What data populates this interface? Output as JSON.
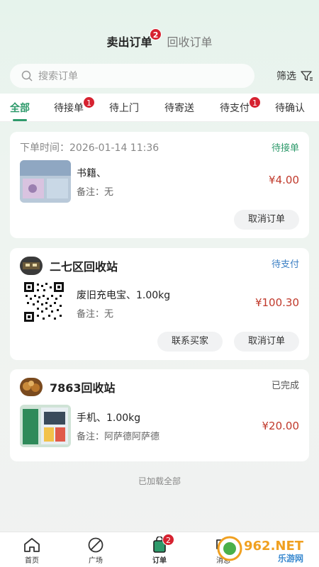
{
  "top_tabs": {
    "sell_label": "卖出订单",
    "sell_badge": "2",
    "recycle_label": "回收订单"
  },
  "search": {
    "placeholder": "搜索订单",
    "filter_label": "筛选"
  },
  "status_tabs": [
    {
      "label": "全部",
      "badge": ""
    },
    {
      "label": "待接单",
      "badge": "1"
    },
    {
      "label": "待上门",
      "badge": ""
    },
    {
      "label": "待寄送",
      "badge": ""
    },
    {
      "label": "待支付",
      "badge": "1"
    },
    {
      "label": "待确认",
      "badge": ""
    }
  ],
  "orders": [
    {
      "header_text": "下单时间：2026-01-14 11:36",
      "status": "待接单",
      "status_color": "#2e9a6b",
      "item": "书籍、",
      "note": "备注：无",
      "price": "¥4.00",
      "buttons": [
        "取消订单"
      ]
    },
    {
      "shop": "二七区回收站",
      "status": "待支付",
      "status_color": "#3b7fc4",
      "item": "废旧充电宝、1.00kg",
      "note": "备注：无",
      "price": "¥100.30",
      "buttons": [
        "联系买家",
        "取消订单"
      ]
    },
    {
      "shop": "7863回收站",
      "status": "已完成",
      "status_color": "#555555",
      "item": "手机、1.00kg",
      "note": "备注：阿萨德阿萨德",
      "price": "¥20.00",
      "buttons": []
    }
  ],
  "footer_text": "已加载全部",
  "nav": {
    "home": "首页",
    "square": "广场",
    "orders": "订单",
    "orders_badge": "2",
    "messages": "消息"
  },
  "watermark": {
    "text": "962.NET",
    "subtext": "乐游网"
  },
  "colors": {
    "accent": "#2e9a6b",
    "price": "#c0392b",
    "badge": "#d62230"
  }
}
